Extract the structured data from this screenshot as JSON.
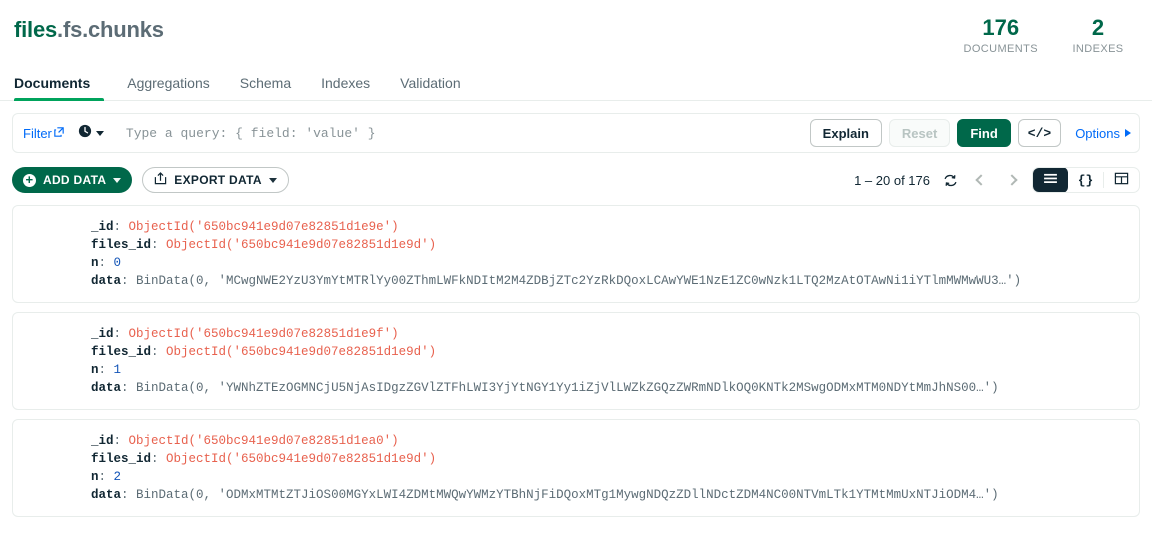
{
  "header": {
    "namespace_db": "files",
    "namespace_rest": ".fs.chunks",
    "stats": [
      {
        "value": "176",
        "label": "DOCUMENTS"
      },
      {
        "value": "2",
        "label": "INDEXES"
      }
    ]
  },
  "tabs": [
    {
      "label": "Documents",
      "active": true
    },
    {
      "label": "Aggregations",
      "active": false
    },
    {
      "label": "Schema",
      "active": false
    },
    {
      "label": "Indexes",
      "active": false
    },
    {
      "label": "Validation",
      "active": false
    }
  ],
  "querybar": {
    "filter_label": "Filter",
    "filter_icon": "external-link-icon",
    "history_icon": "clock-icon",
    "input_value": "",
    "input_placeholder": "Type a query: { field: 'value' }",
    "explain_label": "Explain",
    "reset_label": "Reset",
    "find_label": "Find",
    "code_label": "</>",
    "options_label": "Options"
  },
  "toolbar": {
    "add_data_label": "ADD DATA",
    "export_data_label": "EXPORT DATA",
    "export_icon": "export-icon",
    "range_text": "1 – 20 of 176",
    "refresh_icon": "refresh-icon",
    "prev_icon": "chevron-left-icon",
    "next_icon": "chevron-right-icon",
    "view_list_icon": "list-view-icon",
    "view_json_label": "{}",
    "view_table_icon": "table-view-icon"
  },
  "colors": {
    "brand_green": "#00684a",
    "accent_green": "#00a35c",
    "link_blue": "#016bf8",
    "objectid_red": "#e8614e",
    "number_blue": "#1254b7",
    "dark": "#112733"
  },
  "documents": [
    {
      "fields": [
        {
          "key": "_id",
          "value": "ObjectId('650bc941e9d07e82851d1e9e')",
          "type": "objectid"
        },
        {
          "key": "files_id",
          "value": "ObjectId('650bc941e9d07e82851d1e9d')",
          "type": "objectid"
        },
        {
          "key": "n",
          "value": "0",
          "type": "number"
        },
        {
          "key": "data",
          "value": "BinData(0, 'MCwgNWE2YzU3YmYtMTRlYy00ZThmLWFkNDItM2M4ZDBjZTc2YzRkDQoxLCAwYWE1NzE1ZC0wNzk1LTQ2MzAtOTAwNi1iYTlmMWMwWU3…')",
          "type": "bindata"
        }
      ]
    },
    {
      "fields": [
        {
          "key": "_id",
          "value": "ObjectId('650bc941e9d07e82851d1e9f')",
          "type": "objectid"
        },
        {
          "key": "files_id",
          "value": "ObjectId('650bc941e9d07e82851d1e9d')",
          "type": "objectid"
        },
        {
          "key": "n",
          "value": "1",
          "type": "number"
        },
        {
          "key": "data",
          "value": "BinData(0, 'YWNhZTEzOGMNCjU5NjAsIDgzZGVlZTFhLWI3YjYtNGY1Yy1iZjVlLWZkZGQzZWRmNDlkOQ0KNTk2MSwgODMxMTM0NDYtMmJhNS00…')",
          "type": "bindata"
        }
      ]
    },
    {
      "fields": [
        {
          "key": "_id",
          "value": "ObjectId('650bc941e9d07e82851d1ea0')",
          "type": "objectid"
        },
        {
          "key": "files_id",
          "value": "ObjectId('650bc941e9d07e82851d1e9d')",
          "type": "objectid"
        },
        {
          "key": "n",
          "value": "2",
          "type": "number"
        },
        {
          "key": "data",
          "value": "BinData(0, 'ODMxMTMtZTJiOS00MGYxLWI4ZDMtMWQwYWMzYTBhNjFiDQoxMTg1MywgNDQzZDllNDctZDM4NC00NTVmLTk1YTMtMmUxNTJiODM4…')",
          "type": "bindata"
        }
      ]
    }
  ]
}
